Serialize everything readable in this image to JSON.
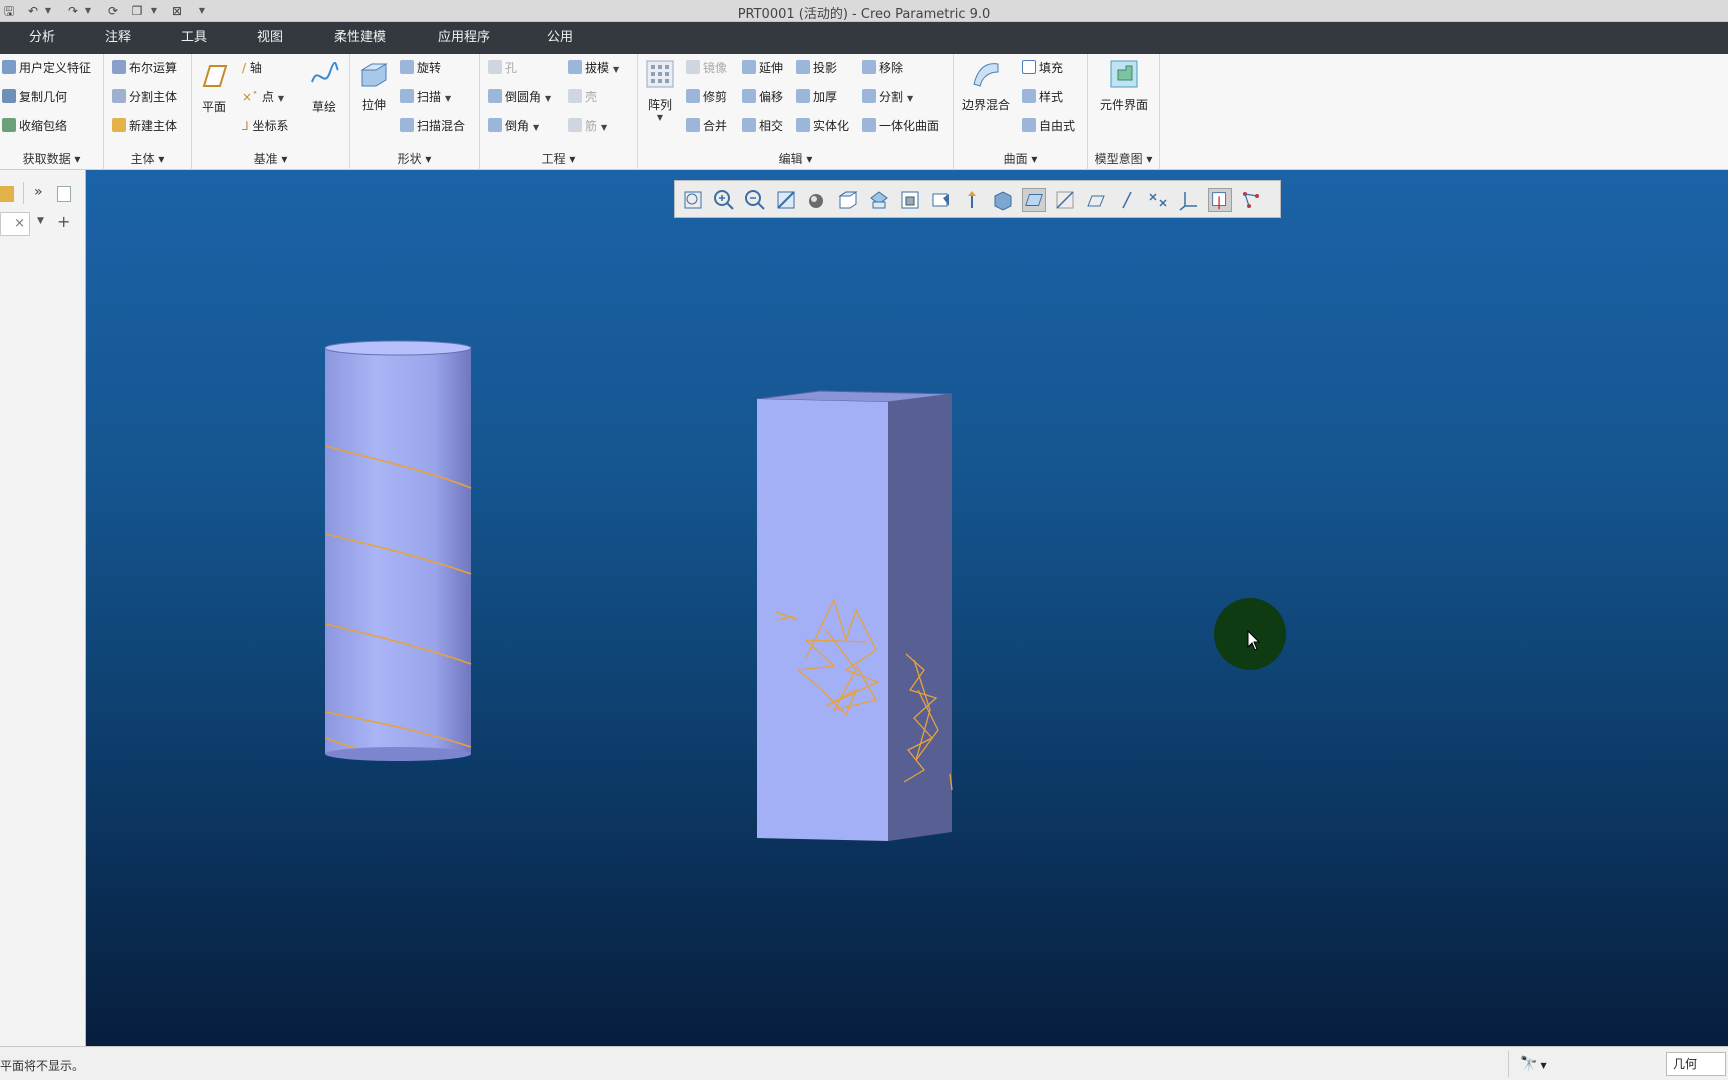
{
  "window": {
    "title": "PRT0001 (活动的) - Creo Parametric 9.0"
  },
  "menu": {
    "tabs": [
      "分析",
      "注释",
      "工具",
      "视图",
      "柔性建模",
      "应用程序",
      "公用"
    ]
  },
  "ribbon": {
    "get_data": {
      "label": "获取数据",
      "items": [
        "用户定义特征",
        "复制几何",
        "收缩包络"
      ]
    },
    "body": {
      "label": "主体",
      "items": [
        "布尔运算",
        "分割主体",
        "新建主体"
      ]
    },
    "datum": {
      "label": "基准",
      "plane": "平面",
      "axis": "轴",
      "point": "点",
      "csys": "坐标系",
      "sketch": "草绘"
    },
    "shape": {
      "label": "形状",
      "extrude": "拉伸",
      "revolve": "旋转",
      "sweep": "扫描",
      "swept_blend": "扫描混合"
    },
    "engineering": {
      "label": "工程",
      "hole": "孔",
      "round": "倒圆角",
      "chamfer": "倒角",
      "draft": "拔模",
      "shell": "壳",
      "rib": "筋"
    },
    "editing": {
      "label": "编辑",
      "pattern": "阵列",
      "mirror": "镜像",
      "extend": "延伸",
      "project": "投影",
      "remove": "移除",
      "trim": "修剪",
      "offset": "偏移",
      "thicken": "加厚",
      "split": "分割",
      "merge": "合并",
      "intersect": "相交",
      "solidify": "实体化",
      "unified_surface": "一体化曲面"
    },
    "surfaces": {
      "label": "曲面",
      "boundary_blend": "边界混合",
      "fill": "填充",
      "style": "样式",
      "freestyle": "自由式"
    },
    "model_intent": {
      "label": "模型意图",
      "component_interface": "元件界面"
    }
  },
  "status": {
    "message": "平面将不显示。",
    "filter": "几何"
  },
  "colors": {
    "accent_curve": "#e8a23a",
    "model_face": "#a3b0f5",
    "model_shadow": "#585f93",
    "cursor_halo": "#0f3b12"
  }
}
